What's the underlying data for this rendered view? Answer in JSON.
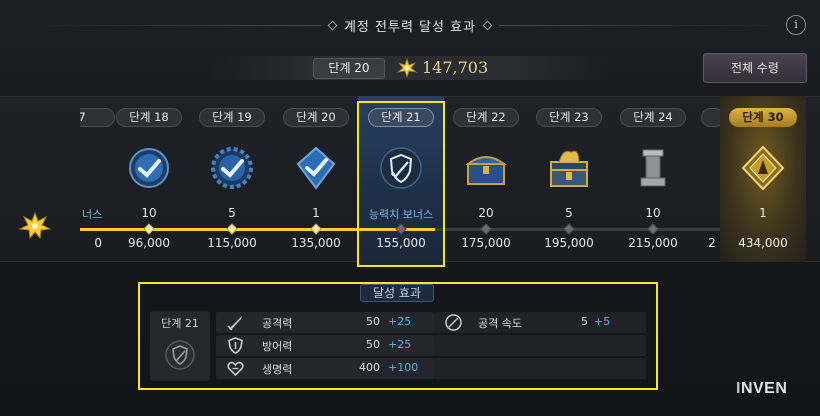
{
  "header": {
    "title": "계정 전투력 달성 효과",
    "info_label": "i"
  },
  "current": {
    "stage_label": "단계 20",
    "power_value": "147,703",
    "collect_all_label": "전체 수령"
  },
  "track": {
    "partial_left_label": "너스",
    "partial_left_need": "0",
    "partial_left_pill": "7",
    "partial_right_pill": "",
    "partial_right_need": "2",
    "nodes": [
      {
        "stage": "단계 18",
        "count": "10",
        "need": "96,000",
        "reward": "blue-check-medal",
        "achieved": true
      },
      {
        "stage": "단계 19",
        "count": "5",
        "need": "115,000",
        "reward": "blue-check-gear",
        "achieved": true
      },
      {
        "stage": "단계 20",
        "count": "1",
        "need": "135,000",
        "reward": "blue-check-crystal",
        "achieved": true
      },
      {
        "stage": "단계 21",
        "count": "능력치 보너스",
        "need": "155,000",
        "reward": "shield-sword",
        "achieved": false,
        "selected": true
      },
      {
        "stage": "단계 22",
        "count": "20",
        "need": "175,000",
        "reward": "treasure-chest-blue",
        "achieved": false
      },
      {
        "stage": "단계 23",
        "count": "5",
        "need": "195,000",
        "reward": "dragon-chest",
        "achieved": false
      },
      {
        "stage": "단계 24",
        "count": "10",
        "need": "215,000",
        "reward": "stone-pedestal",
        "achieved": false
      }
    ],
    "final": {
      "stage": "단계 30",
      "count": "1",
      "need": "434,000",
      "reward": "golden-emblem"
    }
  },
  "bonus": {
    "title": "달성 효과",
    "stage_label": "단계 21",
    "stats_left": [
      {
        "icon": "sword-icon",
        "name": "공격력",
        "value": "50",
        "plus": "+25"
      },
      {
        "icon": "armor-icon",
        "name": "방어력",
        "value": "50",
        "plus": "+25"
      },
      {
        "icon": "heart-icon",
        "name": "생명력",
        "value": "400",
        "plus": "+100"
      }
    ],
    "stats_right": [
      {
        "icon": "attack-speed-icon",
        "name": "공격 속도",
        "value": "5",
        "plus": "+5"
      }
    ]
  },
  "watermark": {
    "prefix": "I",
    "text": "NVEN"
  },
  "colors": {
    "gold_line": "#f2cf2c",
    "highlight_yellow": "#f5ea15",
    "bonus_plus": "#58b3e8",
    "power_gold": "#e9d48a"
  }
}
